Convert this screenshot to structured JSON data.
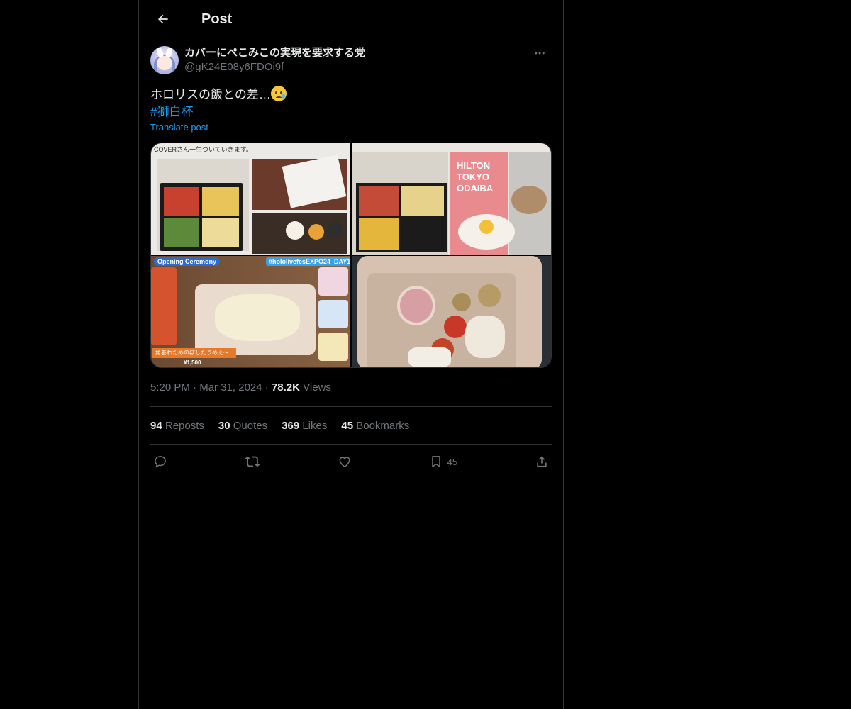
{
  "header": {
    "title": "Post"
  },
  "author": {
    "display_name": "カバーにぺこみこの実現を要求する党",
    "handle": "@gK24E08y6FDOi9f"
  },
  "post": {
    "text": "ホロリスの飯との差…",
    "hashtag": "#獅白杯",
    "translate_label": "Translate post"
  },
  "media": {
    "image1_caption": "COVERさん一生ついていきます。",
    "image2_caption": "HILTON TOKYO ODAIBA",
    "image3_badge": "Opening Ceremony",
    "image3_tag": "#hololivefesEXPO24_DAY1",
    "image3_caption": "角巻わためのぼしたうめぇ～",
    "image3_price": "¥1,500"
  },
  "meta": {
    "time": "5:20 PM",
    "separator": "·",
    "date": "Mar 31, 2024",
    "views_count": "78.2K",
    "views_label": "Views"
  },
  "stats": {
    "reposts_count": "94",
    "reposts_label": "Reposts",
    "quotes_count": "30",
    "quotes_label": "Quotes",
    "likes_count": "369",
    "likes_label": "Likes",
    "bookmarks_count": "45",
    "bookmarks_label": "Bookmarks"
  },
  "actions": {
    "bookmark_count": "45"
  },
  "icons": {
    "back": "arrow-left-icon",
    "more": "more-horizontal-icon",
    "reply": "reply-icon",
    "repost": "repost-icon",
    "like": "heart-icon",
    "bookmark": "bookmark-icon",
    "share": "share-icon"
  },
  "colors": {
    "background": "#000000",
    "text": "#e7e9ea",
    "muted": "#71767b",
    "accent": "#1d9bf0",
    "border": "#2f3336"
  }
}
